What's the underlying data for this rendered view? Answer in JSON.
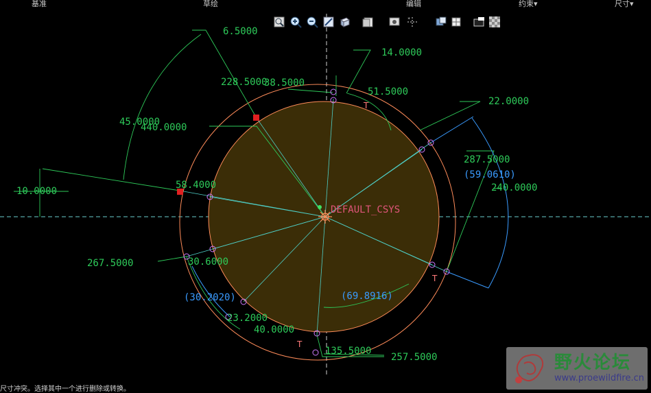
{
  "menu": {
    "items": [
      "基准",
      "草绘",
      "编辑",
      "约束▾",
      "尺寸▾"
    ]
  },
  "toolbar": {
    "icons": [
      "refit-icon",
      "zoom-in-icon",
      "zoom-out-icon",
      "repaint-icon",
      "shaded-view-icon",
      "display-style-icon",
      "view-manager-icon",
      "datum-display-icon",
      "sketch-display-icon",
      "orient-icon",
      "sketch-view-icon",
      "background-icon"
    ]
  },
  "sketch": {
    "csys_label": "DEFAULT_CSYS",
    "dimensions_green": [
      "6.5000",
      "14.0000",
      "228.5000",
      "38.5000",
      "51.5000",
      "22.0000",
      "45.0000",
      "440.0000",
      "287.5000",
      "240.0000",
      "10.0000",
      "58.4000",
      "267.5000",
      "30.6000",
      "23.2000",
      "40.0000",
      "135.5000",
      "257.5000"
    ],
    "dimensions_blue": [
      "(59.0610)",
      "(30.2020)",
      "(69.8916)"
    ],
    "tangent_marks": [
      "T",
      "T",
      "T"
    ],
    "colors": {
      "fill": "#3b2d07",
      "outer_circle": "#ff8c5a",
      "dimension": "#2ecb5a",
      "reference_dimension": "#3a9bff",
      "centerline": "#6ad0d0",
      "construction": "#4fd0c8"
    }
  },
  "status": {
    "message": "尺寸冲突。选择其中一个进行删除或转换。"
  },
  "watermark": {
    "title": "野火论坛",
    "url": "www.proewildfire.cn"
  }
}
